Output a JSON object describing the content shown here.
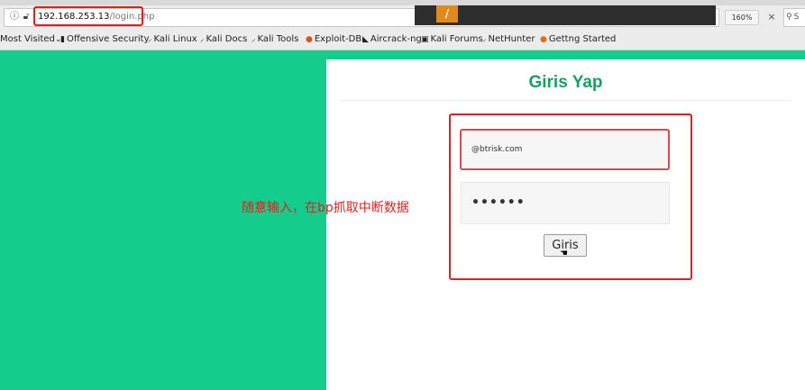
{
  "browser": {
    "url_host": "192.168.253.13",
    "url_path": "/login.php",
    "zoom": "160%",
    "clear_glyph": "×",
    "search_placeholder": "S",
    "overlay_logo_glyph": "/"
  },
  "bookmarks": [
    {
      "label": "Most Visited",
      "icon": "chevron-down-icon"
    },
    {
      "label": "Offensive Security",
      "icon": "offsec-icon"
    },
    {
      "label": "Kali Linux",
      "icon": "kali-dragon-icon"
    },
    {
      "label": "Kali Docs",
      "icon": "kali-dragon-icon"
    },
    {
      "label": "Kali Tools",
      "icon": "kali-dragon-icon"
    },
    {
      "label": "Exploit-DB",
      "icon": "exploitdb-icon"
    },
    {
      "label": "Aircrack-ng",
      "icon": "aircrack-icon"
    },
    {
      "label": "Kali Forums",
      "icon": "forum-icon"
    },
    {
      "label": "NetHunter",
      "icon": "kali-dragon-icon"
    },
    {
      "label": "Gettng Started",
      "icon": "firefox-icon"
    }
  ],
  "login": {
    "title": "Giris Yap",
    "email_value": "@btrisk.com",
    "password_value": "••••••",
    "submit_label": "Giris"
  },
  "annotation": "随意输入，在bp抓取中断数据",
  "colors": {
    "page_bg": "#14cc8c",
    "title_green": "#1a9e62",
    "highlight_red": "#e02020"
  }
}
